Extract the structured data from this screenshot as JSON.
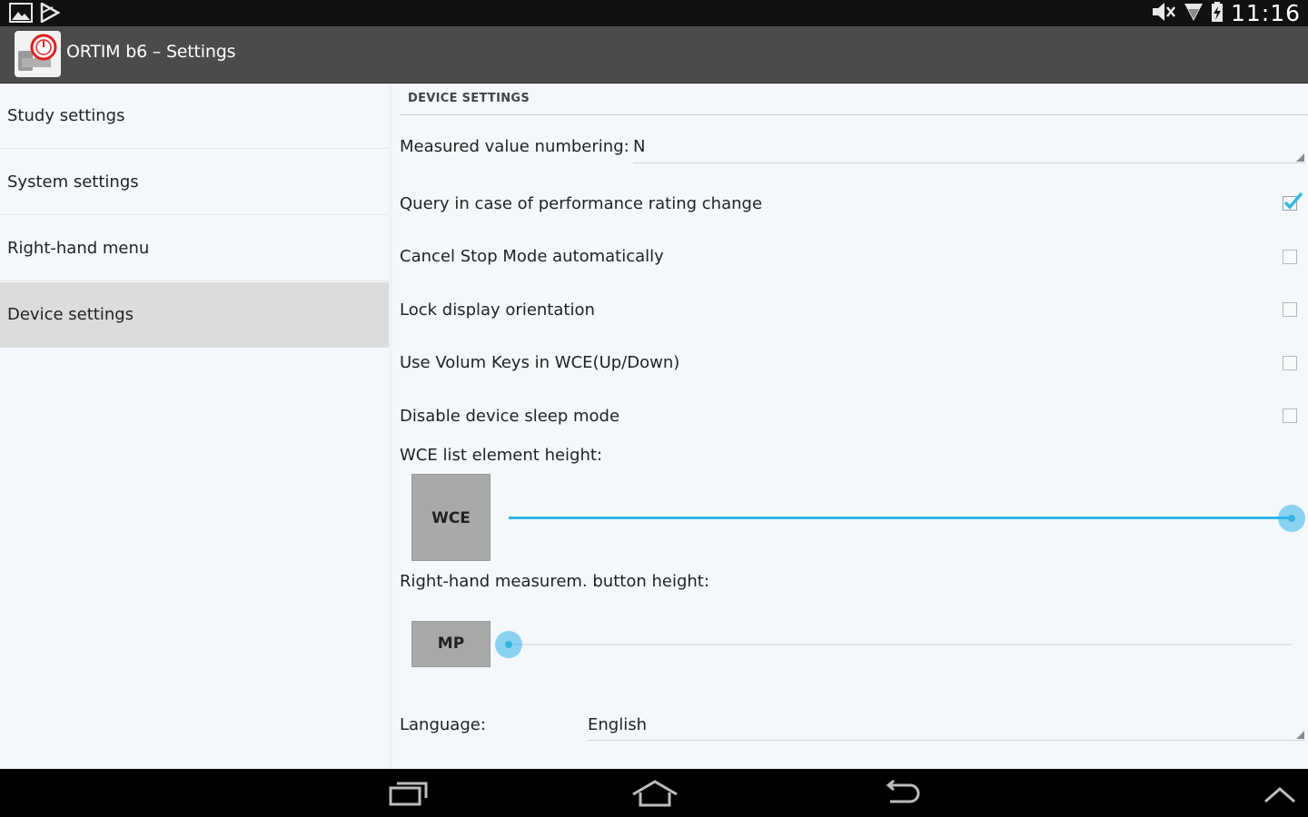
{
  "status_bar": {
    "time": "11:16",
    "icons_left": [
      "picture-icon",
      "play-store-icon"
    ],
    "icons_right": [
      "mute-icon",
      "wifi-icon",
      "battery-charging-icon"
    ]
  },
  "action_bar": {
    "title": "ORTIM b6 – Settings",
    "app_icon": "ortim-app-icon"
  },
  "sidebar": {
    "items": [
      {
        "label": "Study settings",
        "active": false
      },
      {
        "label": "System settings",
        "active": false
      },
      {
        "label": "Right-hand menu",
        "active": false
      },
      {
        "label": "Device settings",
        "active": true
      }
    ]
  },
  "device_settings": {
    "header": "DEVICE SETTINGS",
    "measured_value_numbering": {
      "label": "Measured value numbering:",
      "value": "N"
    },
    "checkboxes": [
      {
        "label": "Query in case of performance rating change",
        "checked": true
      },
      {
        "label": "Cancel Stop Mode automatically",
        "checked": false
      },
      {
        "label": "Lock display orientation",
        "checked": false
      },
      {
        "label": "Use Volum Keys in WCE(Up/Down)",
        "checked": false
      },
      {
        "label": "Disable device sleep mode",
        "checked": false
      }
    ],
    "wce_height": {
      "label": "WCE list element height:",
      "preview_label": "WCE",
      "level": 1.0
    },
    "mp_height": {
      "label": "Right-hand measurem. button height:",
      "preview_label": "MP",
      "level": 0.0
    },
    "language": {
      "label": "Language:",
      "value": "English"
    }
  },
  "colors": {
    "accent": "#33b5e5",
    "action_bar": "#4b4b4b",
    "background": "#f4f8fc",
    "selected_item": "#dcdcdc"
  },
  "nav_bar": {
    "buttons": [
      "recent-apps-icon",
      "home-icon",
      "back-icon",
      "collapse-icon"
    ]
  }
}
